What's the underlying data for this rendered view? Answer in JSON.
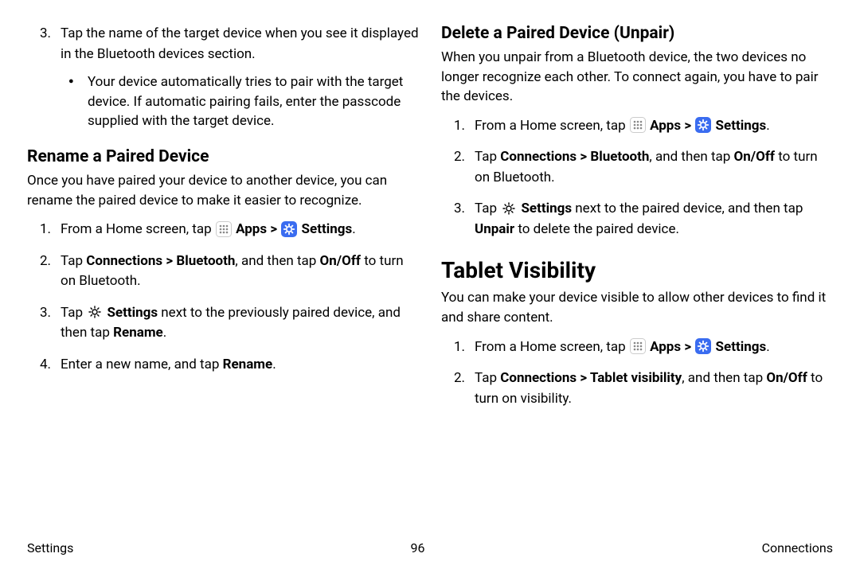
{
  "left": {
    "step3": {
      "num": "3.",
      "text": "Tap the name of the target device when you see it displayed in the Bluetooth devices section.",
      "bullet": "Your device automatically tries to pair with the target device. If automatic pairing fails, enter the passcode supplied with the target device."
    },
    "heading": "Rename a Paired Device",
    "intro": "Once you have paired your device to another device, you can rename the paired device to make it easier to recognize.",
    "steps": {
      "s1": {
        "num": "1.",
        "pre": "From a Home screen, tap ",
        "apps": "Apps",
        "sep": " > ",
        "settings": "Settings",
        "post": "."
      },
      "s2": {
        "num": "2.",
        "pre": "Tap ",
        "b1": "Connections > Bluetooth",
        "mid": ", and then tap ",
        "b2": "On/Off",
        "post": " to turn on Bluetooth."
      },
      "s3": {
        "num": "3.",
        "pre": "Tap ",
        "b1": "Settings",
        "mid": " next to the previously paired device, and then tap ",
        "b2": "Rename",
        "post": "."
      },
      "s4": {
        "num": "4.",
        "pre": "Enter a new name, and tap ",
        "b1": "Rename",
        "post": "."
      }
    }
  },
  "right": {
    "heading1": "Delete a Paired Device (Unpair)",
    "intro1": "When you unpair from a Bluetooth device, the two devices no longer recognize each other. To connect again, you have to pair the devices.",
    "steps1": {
      "s1": {
        "num": "1.",
        "pre": "From a Home screen, tap ",
        "apps": "Apps",
        "sep": " > ",
        "settings": "Settings",
        "post": "."
      },
      "s2": {
        "num": "2.",
        "pre": "Tap ",
        "b1": "Connections > Bluetooth",
        "mid": ", and then tap ",
        "b2": "On/Off",
        "post": " to turn on Bluetooth."
      },
      "s3": {
        "num": "3.",
        "pre": "Tap ",
        "b1": "Settings",
        "mid": " next to the paired device, and then tap ",
        "b2": "Unpair",
        "post": " to delete the paired device."
      }
    },
    "heading2": "Tablet Visibility",
    "intro2": "You can make your device visible to allow other devices to find it and share content.",
    "steps2": {
      "s1": {
        "num": "1.",
        "pre": "From a Home screen, tap ",
        "apps": "Apps",
        "sep": " > ",
        "settings": "Settings",
        "post": "."
      },
      "s2": {
        "num": "2.",
        "pre": "Tap ",
        "b1": "Connections > Tablet visibility",
        "mid": ", and then tap ",
        "b2": "On/Off",
        "post": " to turn on visibility."
      }
    }
  },
  "footer": {
    "left": "Settings",
    "center": "96",
    "right": "Connections"
  }
}
